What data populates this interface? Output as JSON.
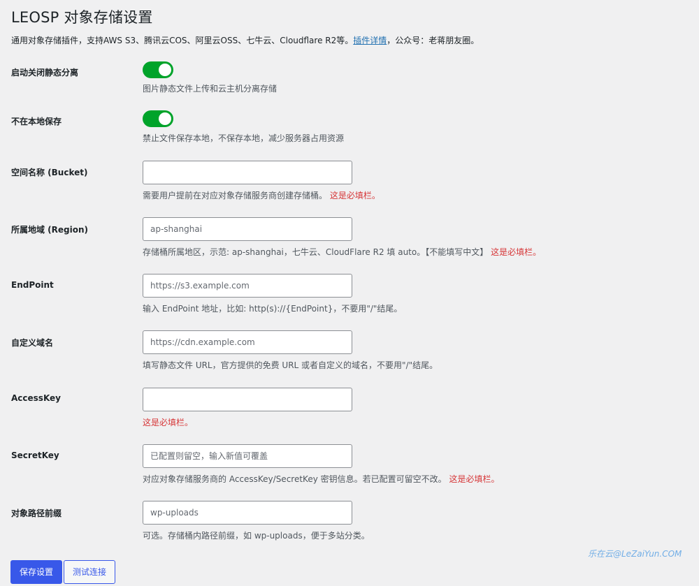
{
  "page": {
    "title": "LEOSP 对象存储设置",
    "intro_text": "通用对象存储插件，支持AWS S3、腾讯云COS、阿里云OSS、七牛云、Cloudflare R2等。",
    "intro_link": "插件详情",
    "intro_suffix": "，公众号：老蒋朋友圈。"
  },
  "settings": {
    "static_separation": {
      "label": "启动关闭静态分离",
      "enabled": true,
      "description": "图片静态文件上传和云主机分离存储"
    },
    "no_local_save": {
      "label": "不在本地保存",
      "enabled": true,
      "description": "禁止文件保存本地，不保存本地，减少服务器占用资源"
    },
    "bucket": {
      "label": "空间名称 (Bucket)",
      "value": "",
      "placeholder": "",
      "description": "需要用户提前在对应对象存储服务商创建存储桶。",
      "required_note": "这是必填栏。"
    },
    "region": {
      "label": "所属地域 (Region)",
      "value": "",
      "placeholder": "ap-shanghai",
      "description": "存储桶所属地区，示范: ap-shanghai，七牛云、CloudFlare R2 填 auto。【不能填写中文】",
      "required_note": "这是必填栏。"
    },
    "endpoint": {
      "label": "EndPoint",
      "value": "",
      "placeholder": "https://s3.example.com",
      "description": "输入 EndPoint 地址，比如: http(s)://{EndPoint}，不要用\"/\"结尾。"
    },
    "custom_domain": {
      "label": "自定义域名",
      "value": "",
      "placeholder": "https://cdn.example.com",
      "description": "填写静态文件 URL，官方提供的免费 URL 或者自定义的域名，不要用\"/\"结尾。"
    },
    "access_key": {
      "label": "AccessKey",
      "value": "",
      "placeholder": "",
      "required_note": "这是必填栏。"
    },
    "secret_key": {
      "label": "SecretKey",
      "value": "",
      "placeholder": "已配置则留空，输入新值可覆盖",
      "description": "对应对象存储服务商的 AccessKey/SecretKey 密钥信息。若已配置可留空不改。",
      "required_note": "这是必填栏。"
    },
    "path_prefix": {
      "label": "对象路径前缀",
      "value": "",
      "placeholder": "wp-uploads",
      "description": "可选。存储桶内路径前缀，如 wp-uploads，便于多站分类。"
    }
  },
  "buttons": {
    "save": "保存设置",
    "test": "测试连接"
  },
  "watermark": "乐在云@LeZaiYun.COM",
  "colors": {
    "toggle_on": "#00a32a",
    "required": "#d63638",
    "primary": "#3858e9",
    "link": "#2271b1"
  }
}
